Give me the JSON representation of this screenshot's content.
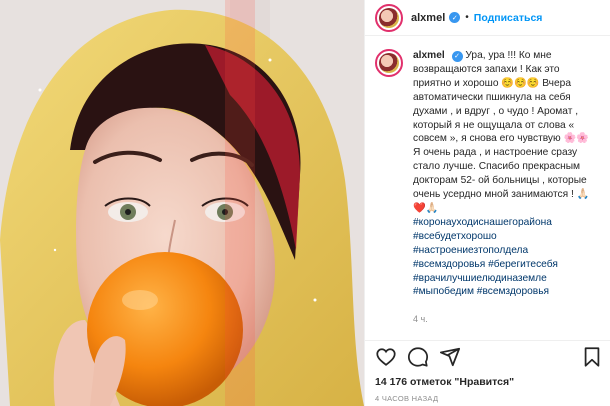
{
  "post": {
    "username": "alxmel",
    "follow_label": "Подписаться",
    "verified": true,
    "caption_text": "Ура, ура !!! Ко мне возвращаются запахи ! Как это приятно и хорошо ☺️☺️☺️ Вчера автоматически пшикнула на себя духами , и вдруг , о чудо ! Аромат , который я не ощущала от слова « совсем », я снова его чувствую 🌸🌸 Я очень рада , и настроение сразу стало лучше. Спасибо прекрасным докторам 52- ой больницы , которые очень усердно мной занимаются ! 🙏🏻 ❤️🙏🏻",
    "hashtags": [
      "#коронауходиснашегорайона",
      "#всебудетхорошо",
      "#настроениезтополдела",
      "#всемздоровья #берегитесебя",
      "#врачилучшиелюдиназемле",
      "#мыпобедим #всемздоровья"
    ],
    "time_short": "4 ч.",
    "likes": "14 176 отметок \"Нравится\"",
    "time_ago": "4 ЧАСОВ НАЗАД"
  },
  "icons": {
    "like": "heart-icon",
    "comment": "comment-icon",
    "share": "share-icon",
    "save": "bookmark-icon"
  },
  "colors": {
    "link": "#0095f6",
    "hashtag": "#00376b",
    "muted": "#8e8e8e",
    "hood": "#e8c85a"
  }
}
